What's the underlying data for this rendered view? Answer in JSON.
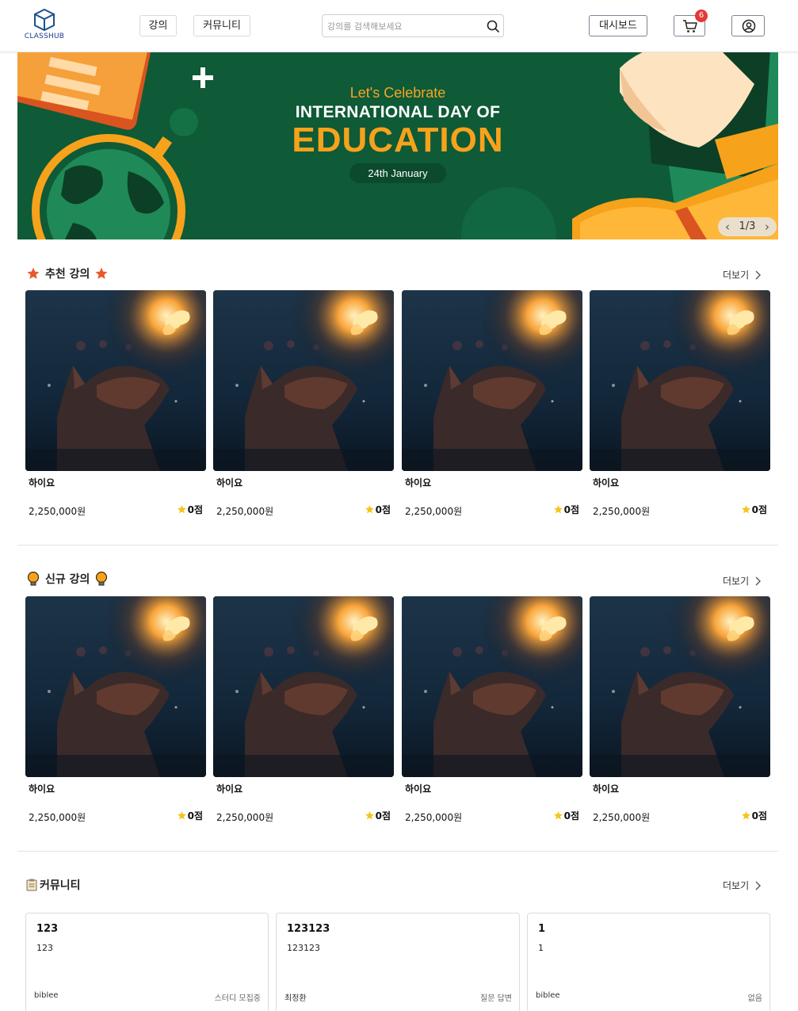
{
  "header": {
    "logo_text": "CLASSHUB",
    "nav": [
      {
        "label": "강의"
      },
      {
        "label": "커뮤니티"
      }
    ],
    "search": {
      "placeholder": "강의를 검색해보세요",
      "value": ""
    },
    "dashboard_label": "대시보드",
    "cart_count": "6"
  },
  "banner": {
    "subtitle": "Let's Celebrate",
    "title_line1": "INTERNATIONAL DAY OF",
    "title_line2": "EDUCATION",
    "date_label": "24th January",
    "pager": "1/3",
    "colors": {
      "background": "#0f5a37",
      "accent": "#f7a21b"
    }
  },
  "recommended": {
    "title": "추천 강의",
    "more_label": "더보기",
    "courses": [
      {
        "title": "하이요",
        "price": "2,250,000원",
        "rating": "0점"
      },
      {
        "title": "하이요",
        "price": "2,250,000원",
        "rating": "0점"
      },
      {
        "title": "하이요",
        "price": "2,250,000원",
        "rating": "0점"
      },
      {
        "title": "하이요",
        "price": "2,250,000원",
        "rating": "0점"
      }
    ]
  },
  "new_courses": {
    "title": "신규 강의",
    "more_label": "더보기",
    "courses": [
      {
        "title": "하이요",
        "price": "2,250,000원",
        "rating": "0점"
      },
      {
        "title": "하이요",
        "price": "2,250,000원",
        "rating": "0점"
      },
      {
        "title": "하이요",
        "price": "2,250,000원",
        "rating": "0점"
      },
      {
        "title": "하이요",
        "price": "2,250,000원",
        "rating": "0점"
      }
    ]
  },
  "community": {
    "title": "커뮤니티",
    "more_label": "더보기",
    "posts": [
      {
        "title": "123",
        "body": "123",
        "author": "biblee",
        "status": "스터디 모집중"
      },
      {
        "title": "123123",
        "body": "123123",
        "author": "최정환",
        "status": "질문 답변"
      },
      {
        "title": "1",
        "body": "1",
        "author": "biblee",
        "status": "없음"
      }
    ]
  },
  "colors": {
    "star": "#f5c518",
    "section_star": "#e8582a",
    "badge": "#e53935"
  }
}
